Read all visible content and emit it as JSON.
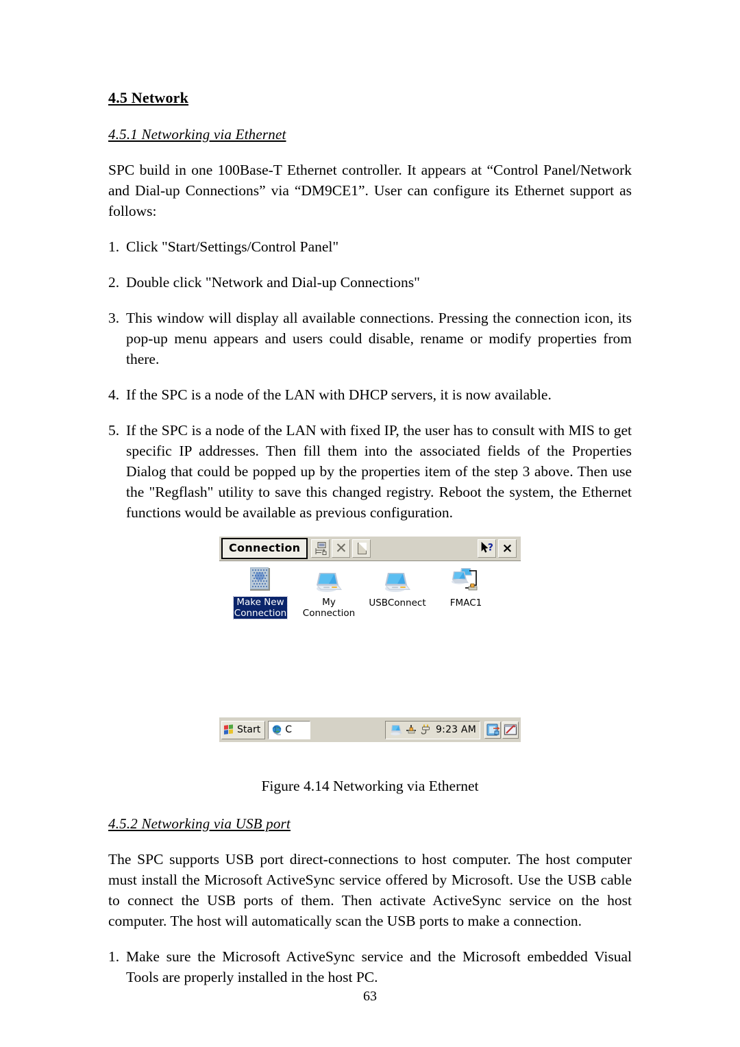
{
  "document": {
    "page_number": "63"
  },
  "section": {
    "heading": "4.5 Network",
    "sub1": "4.5.1 Networking via Ethernet",
    "intro": "SPC build in one 100Base-T Ethernet controller. It appears at “Control Panel/Network and Dial-up Connections” via “DM9CE1”. User can configure its Ethernet support as follows:",
    "steps": [
      {
        "num": "1.",
        "text": "Click \"Start/Settings/Control Panel\""
      },
      {
        "num": "2.",
        "text": "Double click \"Network and Dial-up Connections\""
      },
      {
        "num": "3.",
        "text": "This window will display all available connections. Pressing the connection icon, its pop-up menu appears and users could disable, rename or modify properties from there."
      },
      {
        "num": "4.",
        "text": "If the SPC is a node of the LAN with DHCP servers, it is now available."
      },
      {
        "num": "5.",
        "text": "If the SPC is a node of the LAN with fixed IP, the user has to consult with MIS to get specific IP addresses. Then fill them into the associated fields of the Properties Dialog that could be popped up by the properties item of the step 3 above. Then use the \"Regflash\" utility to save this changed registry. Reboot the system, the Ethernet functions would be available as previous configuration."
      }
    ],
    "figure_caption": "Figure 4.14 Networking via Ethernet",
    "sub2": "4.5.2 Networking via USB port",
    "usb_intro": "The SPC supports USB port direct-connections to host computer. The host computer must install the Microsoft ActiveSync service offered by Microsoft. Use the USB cable to connect the USB ports of them. Then activate ActiveSync service on the host computer. The host will automatically scan the USB ports to make a connection.",
    "usb_steps": [
      {
        "num": "1.",
        "text": "Make sure the Microsoft ActiveSync service and the Microsoft embedded Visual Tools are properly installed in the host PC."
      }
    ]
  },
  "figure": {
    "window": {
      "menu_label": "Connection",
      "toolbar_buttons": [
        {
          "name": "create-connection-icon",
          "title": "Create Connection"
        },
        {
          "name": "delete-icon",
          "title": "Delete"
        },
        {
          "name": "properties-icon",
          "title": "Properties"
        }
      ],
      "help_button": "?",
      "close_button": "×"
    },
    "connections": [
      {
        "label_line1": "Make New",
        "label_line2": "Connection",
        "icon": "make-new-connection-icon",
        "selected": true
      },
      {
        "label_line1": "My",
        "label_line2": "Connection",
        "icon": "dialup-connection-icon",
        "selected": false
      },
      {
        "label_line1": "USBConnect",
        "label_line2": "",
        "icon": "dialup-connection-icon",
        "selected": false
      },
      {
        "label_line1": "FMAC1",
        "label_line2": "",
        "icon": "lan-connection-icon",
        "selected": false
      }
    ],
    "taskbar": {
      "start_label": "Start",
      "task_label": "C",
      "clock": "9:23 AM",
      "tray_icons": [
        "network-status-icon",
        "usb-device-icon",
        "power-plug-icon"
      ],
      "right_icons": [
        "desktop-switch-icon",
        "input-panel-icon"
      ]
    }
  },
  "colors": {
    "selection_blue": "#0a246a",
    "chrome_gray": "#d5d2c6",
    "button_face": "#e8e6dc"
  }
}
